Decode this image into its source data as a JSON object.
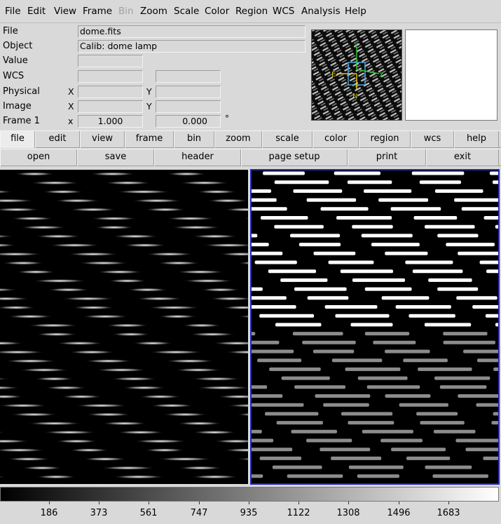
{
  "menubar": [
    "File",
    "Edit",
    "View",
    "Frame",
    "Bin",
    "Zoom",
    "Scale",
    "Color",
    "Region",
    "WCS",
    "Analysis",
    "Help"
  ],
  "menubar_disabled": [
    "Bin"
  ],
  "info": {
    "labels": {
      "file": "File",
      "object": "Object",
      "value": "Value",
      "wcs": "WCS",
      "physical": "Physical",
      "image": "Image",
      "frame": "Frame 1"
    },
    "axis": {
      "x": "X",
      "y": "Y",
      "small_x": "x"
    },
    "file_value": "dome.fits",
    "object_value": "Calib: dome lamp",
    "frame_zoom": "1.000",
    "frame_angle": "0.000",
    "degree": "°"
  },
  "panner": {
    "compass_north": "N",
    "compass_east": "E",
    "wcs_y": "Y",
    "wcs_x": "X"
  },
  "buttons_main": [
    "file",
    "edit",
    "view",
    "frame",
    "bin",
    "zoom",
    "scale",
    "color",
    "region",
    "wcs",
    "help"
  ],
  "buttons_main_active": "file",
  "buttons_file": [
    "open",
    "save",
    "header",
    "page setup",
    "print",
    "exit"
  ],
  "colorbar": {
    "ticks": [
      "186",
      "373",
      "561",
      "747",
      "935",
      "1122",
      "1308",
      "1496",
      "1683"
    ],
    "gradient_from": "#000000",
    "gradient_to": "#ffffff"
  },
  "colors": {
    "frame_highlight": "#2626b8",
    "compass_north": "#e8d000",
    "compass_wcs": "#33cc33",
    "compass_box": "#4aa3df"
  }
}
